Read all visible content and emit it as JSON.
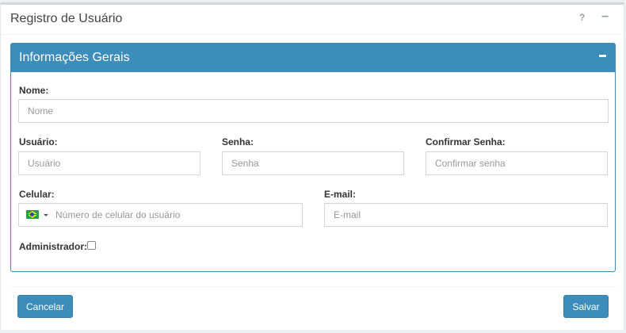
{
  "header": {
    "title": "Registro de Usuário",
    "help_label": "?",
    "collapse_label": "−"
  },
  "panel": {
    "title": "Informações Gerais"
  },
  "form": {
    "nome": {
      "label": "Nome:",
      "placeholder": "Nome",
      "value": ""
    },
    "usuario": {
      "label": "Usuário:",
      "placeholder": "Usuário",
      "value": ""
    },
    "senha": {
      "label": "Senha:",
      "placeholder": "Senha",
      "value": ""
    },
    "confirmar": {
      "label": "Confirmar Senha:",
      "placeholder": "Confirmar senha",
      "value": ""
    },
    "celular": {
      "label": "Celular:",
      "placeholder": "Número de celular do usuário",
      "value": "",
      "country_flag": "brazil-flag-icon"
    },
    "email": {
      "label": "E-mail:",
      "placeholder": "E-mail",
      "value": ""
    },
    "administrador": {
      "label": "Administrador:",
      "checked": false
    }
  },
  "footer": {
    "cancel_label": "Cancelar",
    "save_label": "Salvar"
  },
  "colors": {
    "primary": "#3c8dbc",
    "page_bg": "#ecf0f5"
  }
}
